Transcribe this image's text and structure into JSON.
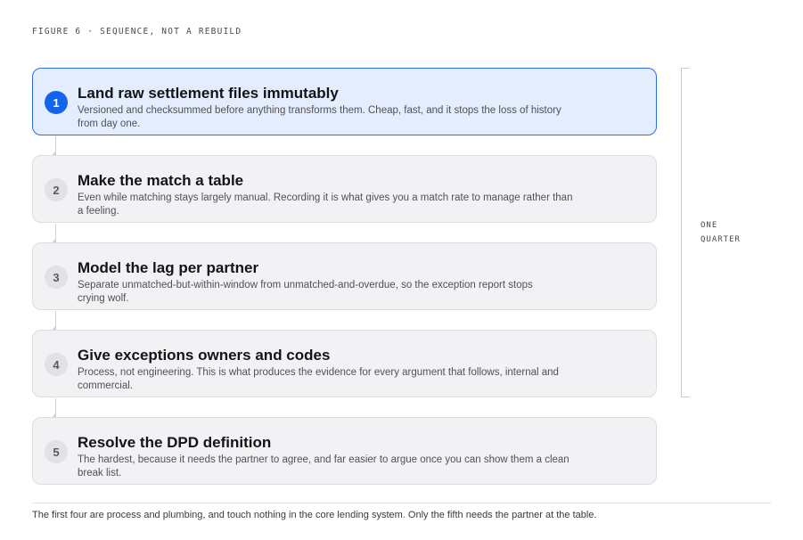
{
  "figure_label": "FIGURE 6 · SEQUENCE, NOT A REBUILD",
  "steps": [
    {
      "number": "1",
      "title": "Land raw settlement files immutably",
      "desc_lines": [
        "Versioned and checksummed before anything transforms them. Cheap, fast, and it stops the loss of history",
        "from day one."
      ],
      "active": true
    },
    {
      "number": "2",
      "title": "Make the match a table",
      "desc_lines": [
        "Even while matching stays largely manual. Recording it is what gives you a match rate to manage rather than",
        "a feeling."
      ]
    },
    {
      "number": "3",
      "title": "Model the lag per partner",
      "desc_lines": [
        "Separate unmatched-but-within-window from unmatched-and-overdue, so the exception report stops",
        "crying wolf."
      ]
    },
    {
      "number": "4",
      "title": "Give exceptions owners and codes",
      "desc_lines": [
        "Process, not engineering. This is what produces the evidence for every argument that follows, internal and",
        "commercial."
      ]
    },
    {
      "number": "5",
      "title": "Resolve the DPD definition",
      "desc_lines": [
        "The hardest, because it needs the partner to agree, and far easier to argue once you can show them a clean",
        "break list."
      ]
    }
  ],
  "bracket_label": {
    "line1": "ONE",
    "line2": "QUARTER"
  },
  "footnote": "The first four are process and plumbing, and touch nothing in the core lending system. Only the fifth needs the partner at the table.",
  "colors": {
    "accent": "#1464eb",
    "active_bg": "#e4edfd",
    "card_bg": "#f2f2f4"
  }
}
